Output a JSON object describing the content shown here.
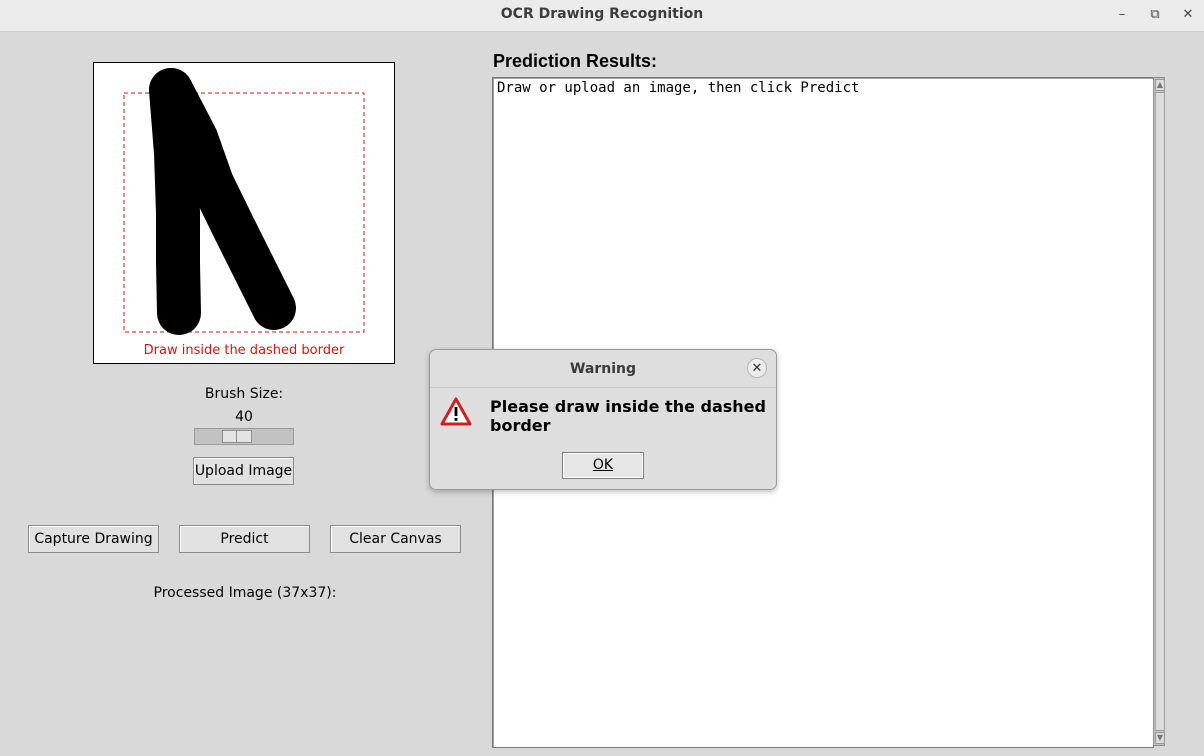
{
  "window": {
    "title": "OCR Drawing Recognition",
    "minimize_symbol": "–",
    "maximize_symbol": "⧉",
    "close_symbol": "✕"
  },
  "canvas": {
    "hint": "Draw inside the dashed border",
    "border_color": "#e01010"
  },
  "brush": {
    "label": "Brush Size:",
    "value": "40",
    "level_fraction": 0.4
  },
  "buttons": {
    "upload": "Upload Image",
    "capture": "Capture Drawing",
    "predict": "Predict",
    "clear": "Clear Canvas"
  },
  "processed": {
    "label": "Processed Image (37x37):"
  },
  "results": {
    "title": "Prediction Results:",
    "text": "Draw or upload an image, then click Predict"
  },
  "dialog": {
    "title": "Warning",
    "message": "Please draw inside the dashed border",
    "ok": "OK",
    "close_symbol": "✕",
    "icon": "warning-triangle-icon",
    "icon_color": "#cc1f1f"
  }
}
